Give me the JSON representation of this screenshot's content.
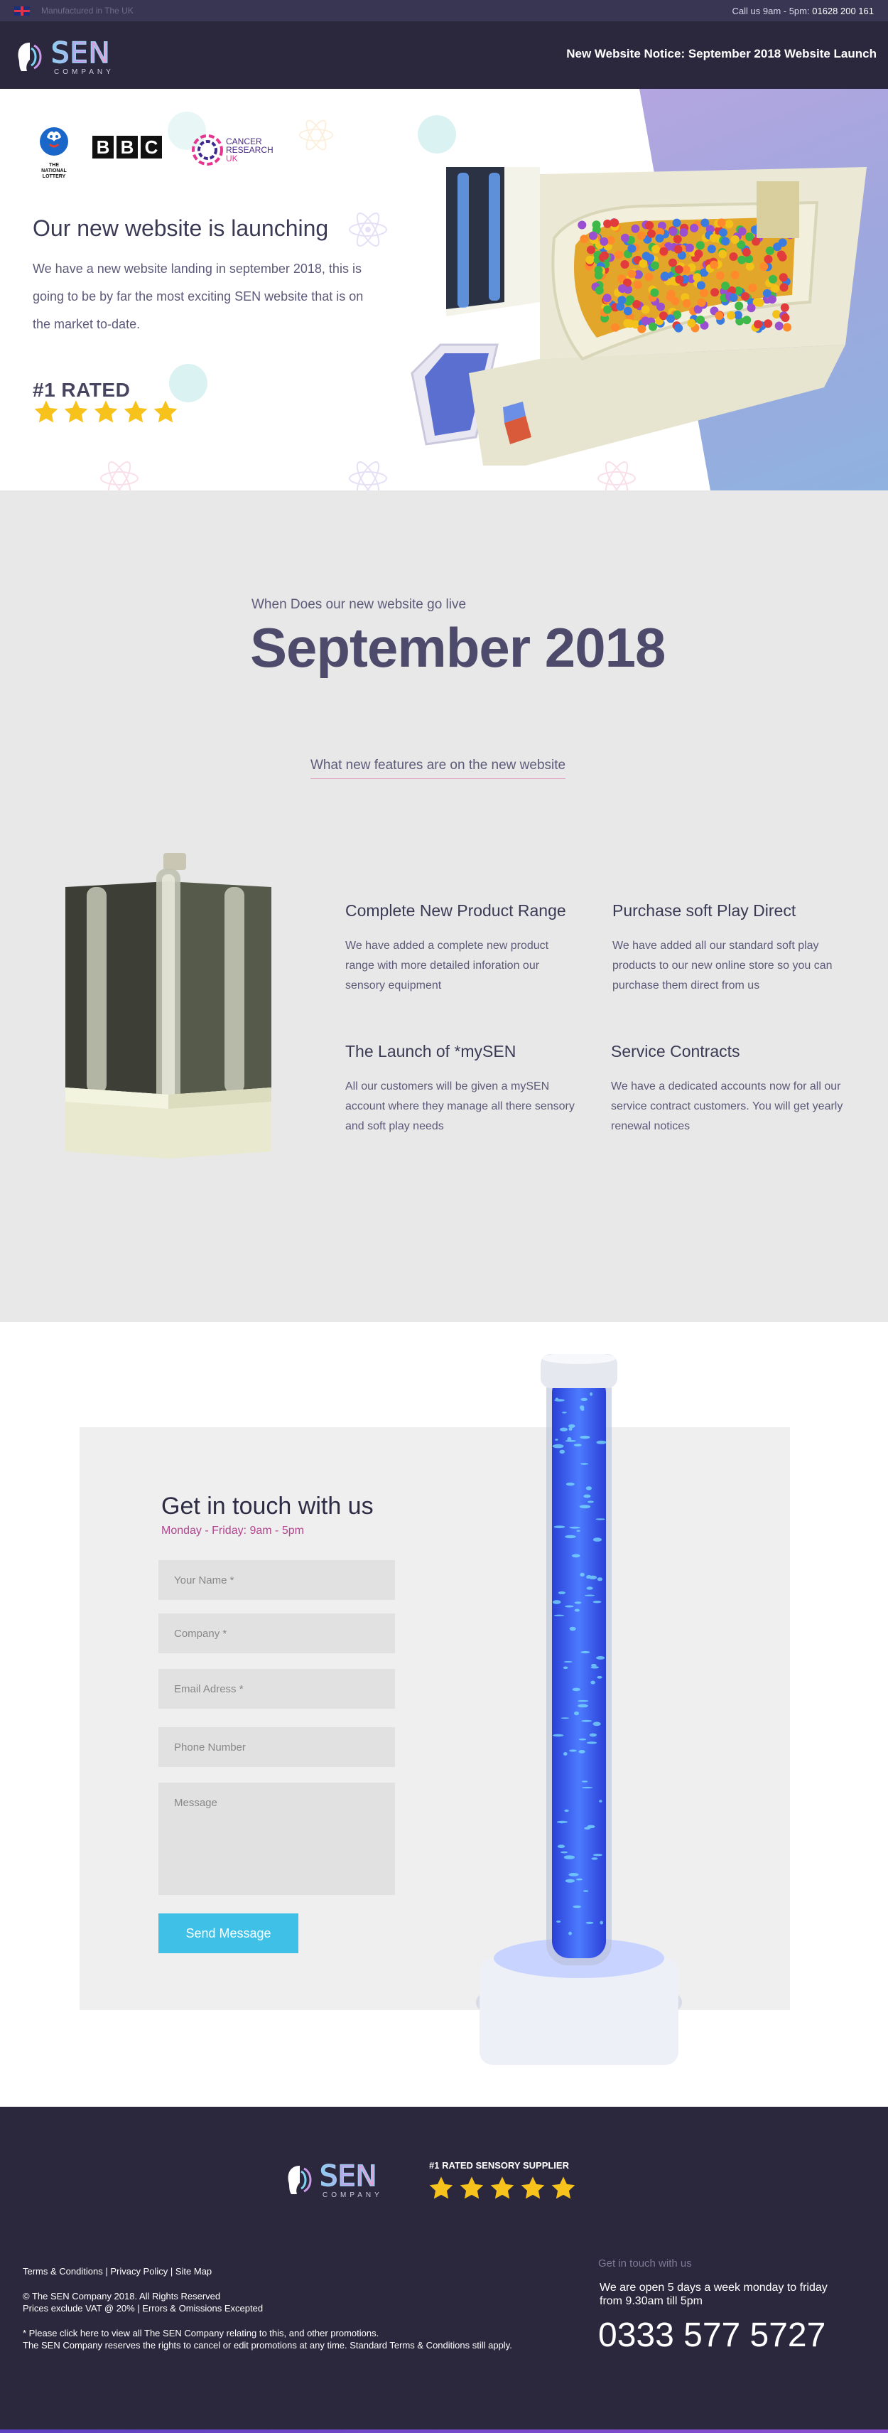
{
  "topbar": {
    "made_in": "Manufactured in The UK",
    "call_prefix": "Call us 9am - 5pm:",
    "phone": "01628 200 161"
  },
  "header": {
    "logo_word": "SEN",
    "logo_sub": "COMPANY",
    "notice": "New Website Notice: September 2018 Website Launch"
  },
  "hero": {
    "partners": {
      "lottery": "THE NATIONAL LOTTERY",
      "bbc": [
        "B",
        "B",
        "C"
      ],
      "cancer_research": [
        "CANCER",
        "RESEARCH",
        "UK"
      ]
    },
    "title": "Our new website is launching",
    "lead": "We have a new website landing in september 2018, this is going to be by far the most exciting SEN website that is on the market to-date.",
    "rated": "#1 RATED",
    "stars": 5
  },
  "when": {
    "kicker": "When Does our new website go live",
    "date": "September 2018",
    "features_link": "What new features are on the new website",
    "features": [
      {
        "title": "Complete New Product Range",
        "text": "We have added a complete new product range with more detailed inforation our sensory equipment"
      },
      {
        "title": "Purchase soft Play Direct",
        "text": "We have added all our standard soft play products to our new online store so you can purchase them direct from us"
      },
      {
        "title": "The Launch of  *mySEN",
        "text": "All our customers will be given a mySEN account where they manage all there sensory and soft play needs"
      },
      {
        "title": "Service Contracts",
        "text": "We have a dedicated accounts now for all our service contract customers. You will get yearly renewal notices"
      }
    ]
  },
  "contact": {
    "title": "Get in touch with us",
    "hours": "Monday - Friday: 9am - 5pm",
    "fields": {
      "name": "Your Name *",
      "company": "Company *",
      "email": "Email Adress *",
      "phone": "Phone Number",
      "message": "Message"
    },
    "send": "Send Message"
  },
  "footer": {
    "logo_word": "SEN",
    "logo_sub": "COMPANY",
    "rating_label": "#1 RATED SENSORY SUPPLIER",
    "stars": 5,
    "links": [
      "Terms & Conditions",
      "Privacy Policy",
      "Site Map"
    ],
    "copyright": "© The SEN Company 2018. All Rights Reserved",
    "vat": "Prices exclude VAT @ 20% | Errors & Omissions Excepted",
    "promo_1": "* Please click here to view all The SEN Company relating to this, and other promotions.",
    "promo_2": "The SEN Company reserves the rights to cancel or edit promotions at any time. Standard Terms & Conditions still apply.",
    "get_in_touch": "Get in touch with us",
    "open": "We are open 5 days a week monday to friday from 9.30am till 5pm",
    "phone": "0333 577 5727"
  },
  "colors": {
    "topbar": "#393654",
    "header": "#2b283d",
    "accent_pink": "#b2478f",
    "button": "#3fc0e6",
    "star": "#f6c21b"
  },
  "icons": [
    "uk-flag-icon",
    "sen-logo-icon",
    "star-icon",
    "atom-icon"
  ]
}
